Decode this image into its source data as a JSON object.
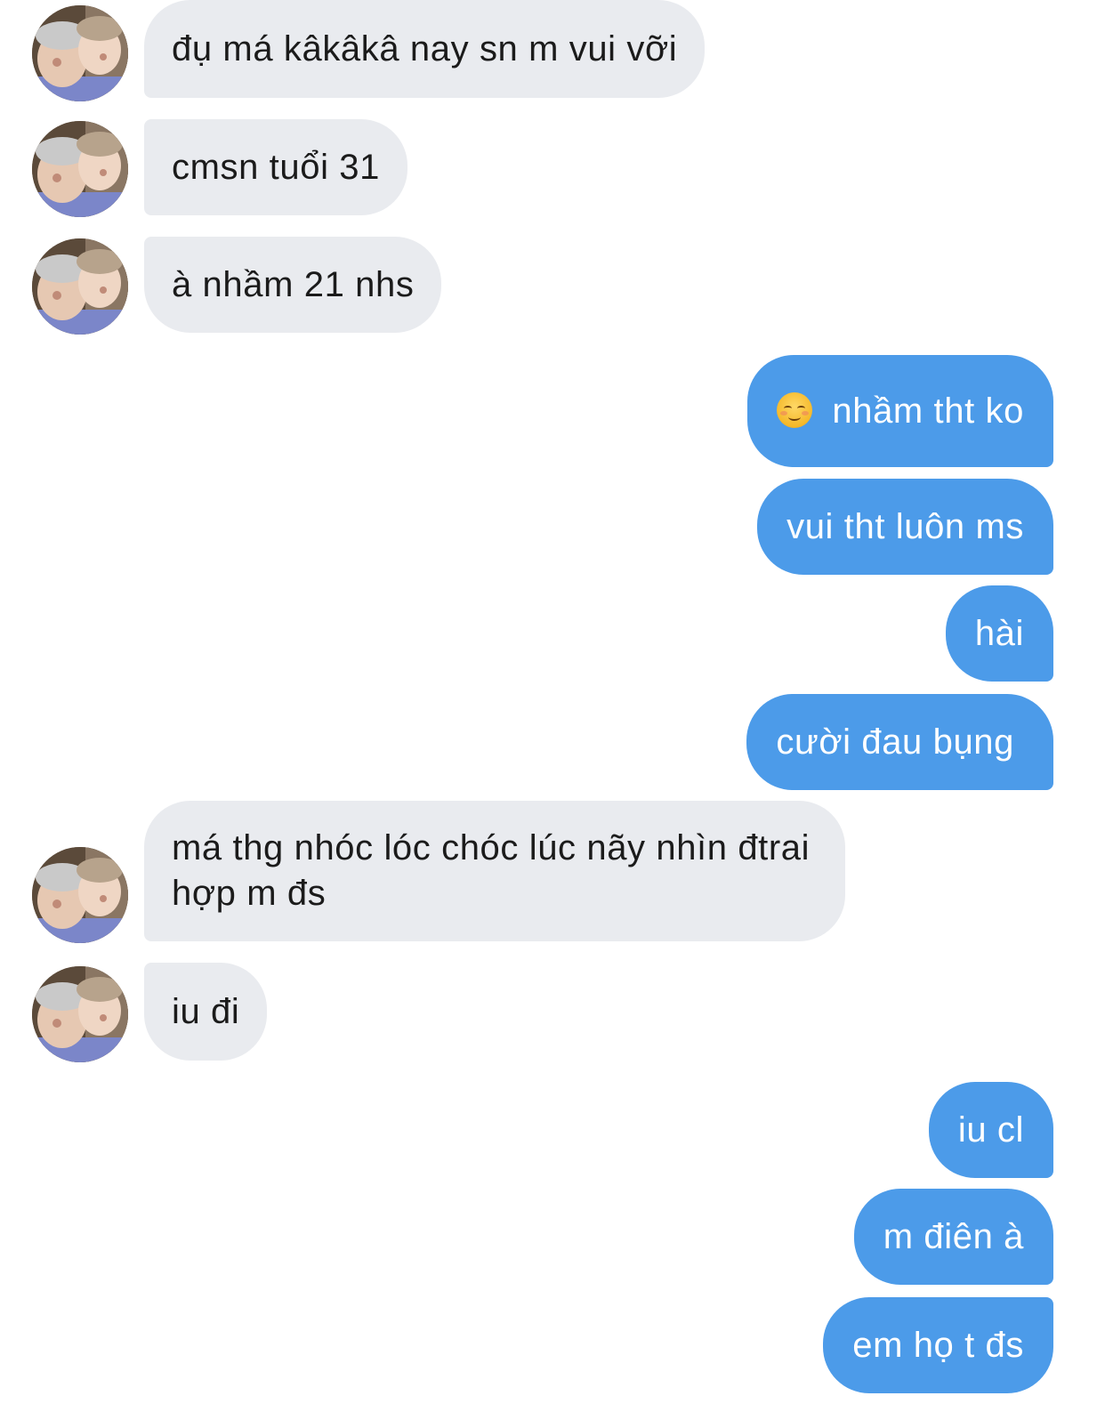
{
  "messages": [
    {
      "side": "incoming",
      "text": "đụ má kâkâkâ nay sn m vui vỡi"
    },
    {
      "side": "incoming",
      "text": "cmsn tuổi 31"
    },
    {
      "side": "incoming",
      "text": "à nhầm 21 nhs"
    },
    {
      "side": "outgoing",
      "emoji": "smiling-face-emoji",
      "text": "nhầm tht ko"
    },
    {
      "side": "outgoing",
      "text": "vui tht luôn ms"
    },
    {
      "side": "outgoing",
      "text": "hài"
    },
    {
      "side": "outgoing",
      "text": "cười đau bụng"
    },
    {
      "side": "incoming",
      "text": "má thg nhóc lóc chóc lúc nãy nhìn đtrai hợp m đs"
    },
    {
      "side": "incoming",
      "text": "iu đi"
    },
    {
      "side": "outgoing",
      "text": "iu cl"
    },
    {
      "side": "outgoing",
      "text": "m điên à"
    },
    {
      "side": "outgoing",
      "text": "em họ t đs"
    }
  ],
  "colors": {
    "incoming_bubble": "#e9ebef",
    "outgoing_bubble": "#4c9be9",
    "incoming_text": "#1b1b1b",
    "outgoing_text": "#ffffff"
  },
  "icons": {
    "avatar": "contact-photo",
    "emoji": "smiling-face-emoji"
  }
}
